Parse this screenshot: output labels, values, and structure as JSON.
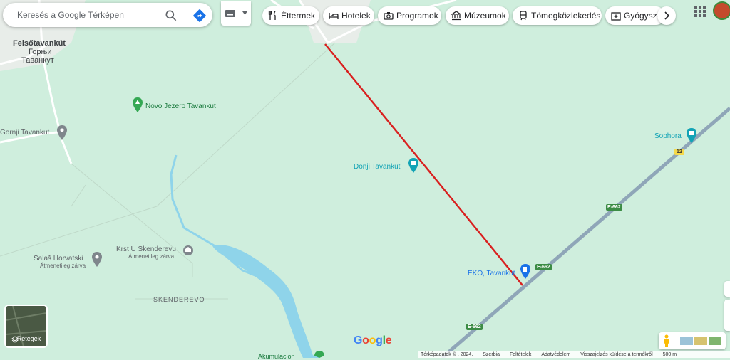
{
  "search": {
    "placeholder": "Keresés a Google Térképen"
  },
  "chips": [
    {
      "label": "Éttermek",
      "icon": "fork-knife-icon"
    },
    {
      "label": "Hotelek",
      "icon": "bed-icon"
    },
    {
      "label": "Programok",
      "icon": "camera-icon"
    },
    {
      "label": "Múzeumok",
      "icon": "museum-icon"
    },
    {
      "label": "Tömegközlekedés",
      "icon": "train-icon"
    },
    {
      "label": "Gyógysze",
      "icon": "pharmacy-icon"
    }
  ],
  "places": {
    "town_hu": "Felsőtavankút",
    "town_sr1": "Горњи",
    "town_sr2": "Таванкут",
    "novo_jezero": "Novo Jezero Tavankut",
    "gornji": "Gornji Tavankut",
    "donji": "Donji Tavankut",
    "sophora": "Sophora",
    "krst": "Krst U Skenderevu",
    "krst_status": "Átmenetileg zárva",
    "salas": "Salaš Horvatski",
    "salas_status": "Átmenetileg zárva",
    "skenderevo": "SKENDEREVO",
    "eko": "EKO, Tavankut",
    "bottom_poi": "Akumulacion"
  },
  "roads": {
    "e662": "E-662",
    "r12": "12"
  },
  "layers_label": "Rétegek",
  "google_logo": "Google",
  "footer": {
    "mapdata": "Térképadatok © , 2024.",
    "country": "Szerbia",
    "terms": "Feltételek",
    "privacy": "Adatvédelem",
    "feedback": "Visszajelzés küldése a termékről",
    "scale": "500 m"
  },
  "colors": {
    "map_bg": "#cfeedd",
    "road": "#8fa6b8",
    "water": "#8fd4ea",
    "route": "#d9201f",
    "poi_green": "#34a853",
    "poi_blue": "#1a73e8"
  }
}
